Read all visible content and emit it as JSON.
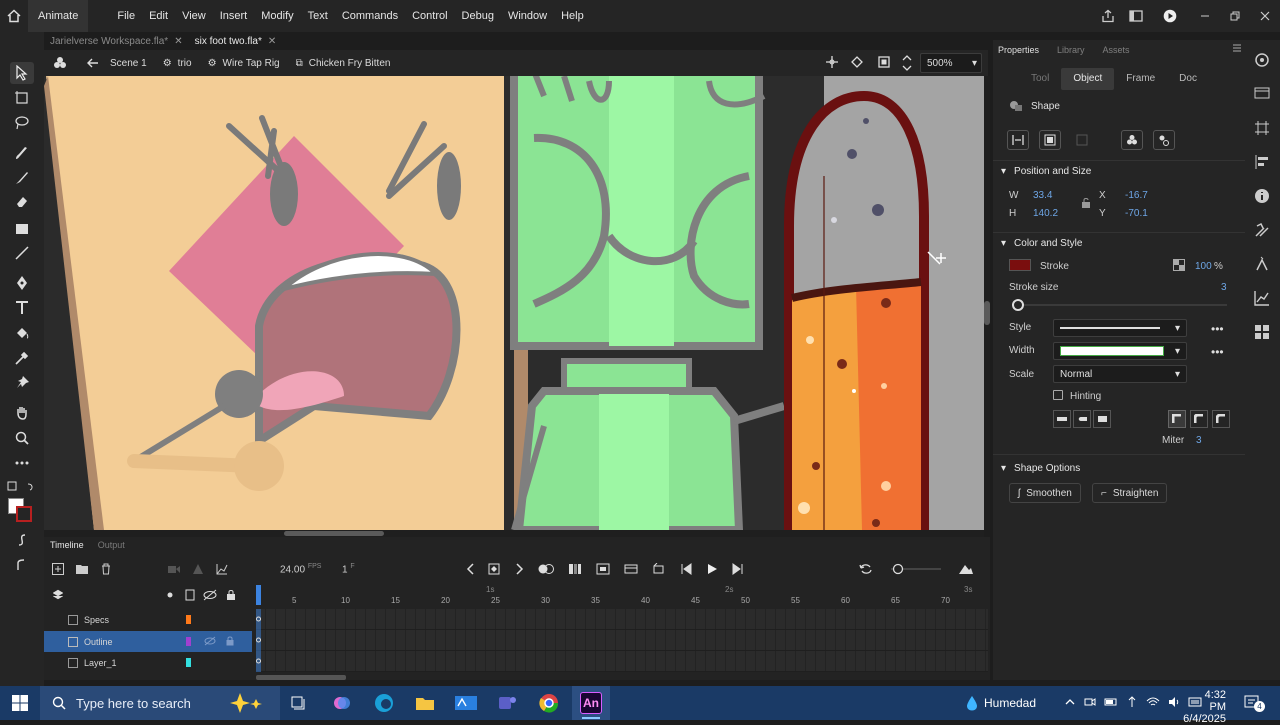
{
  "app": {
    "name": "Animate"
  },
  "menu": [
    "File",
    "Edit",
    "View",
    "Insert",
    "Modify",
    "Text",
    "Commands",
    "Control",
    "Debug",
    "Window",
    "Help"
  ],
  "doc_tabs": [
    {
      "label": "Jarielverse Workspace.fla*",
      "active": false
    },
    {
      "label": "six foot two.fla*",
      "active": true
    }
  ],
  "editbar": {
    "scene": "Scene 1",
    "crumbs": [
      "trio",
      "Wire Tap Rig",
      "Chicken Fry Bitten"
    ],
    "zoom": "500%"
  },
  "timeline": {
    "tabs": [
      "Timeline",
      "Output"
    ],
    "fps": "24.00",
    "fps_unit": "FPS",
    "frame": "1",
    "frame_unit": "F",
    "ruler": [
      "5",
      "10",
      "15",
      "20",
      "25",
      "30",
      "35",
      "40",
      "45",
      "50",
      "55",
      "60",
      "65",
      "70"
    ],
    "ruler_time": [
      "1s",
      "2s",
      "3s"
    ],
    "layers": [
      {
        "name": "Specs",
        "color": "#ff7a1a",
        "selected": false
      },
      {
        "name": "Outline",
        "color": "#a040d0",
        "selected": true
      },
      {
        "name": "Layer_1",
        "color": "#33e0e0",
        "selected": false
      }
    ]
  },
  "properties": {
    "tabs": [
      "Properties",
      "Library",
      "Assets"
    ],
    "segments": [
      "Tool",
      "Object",
      "Frame",
      "Doc"
    ],
    "object_type": "Shape",
    "position_size": {
      "title": "Position and Size",
      "w_label": "W",
      "w": "33.4",
      "h_label": "H",
      "h": "140.2",
      "x_label": "X",
      "x": "-16.7",
      "y_label": "Y",
      "y": "-70.1"
    },
    "color_style": {
      "title": "Color and Style",
      "stroke_label": "Stroke",
      "stroke_color": "#7a0e0e",
      "alpha": "100",
      "alpha_unit": "%",
      "stroke_size_label": "Stroke size",
      "stroke_size": "3",
      "style_label": "Style",
      "width_label": "Width",
      "scale_label": "Scale",
      "scale": "Normal",
      "hinting_label": "Hinting",
      "miter_label": "Miter",
      "miter": "3"
    },
    "shape_options": {
      "title": "Shape Options",
      "smoothen": "Smoothen",
      "straighten": "Straighten"
    }
  },
  "taskbar": {
    "search_placeholder": "Type here to search",
    "weather": "Humedad",
    "time": "4:32 PM",
    "date": "6/4/2025",
    "notif_count": "4"
  }
}
